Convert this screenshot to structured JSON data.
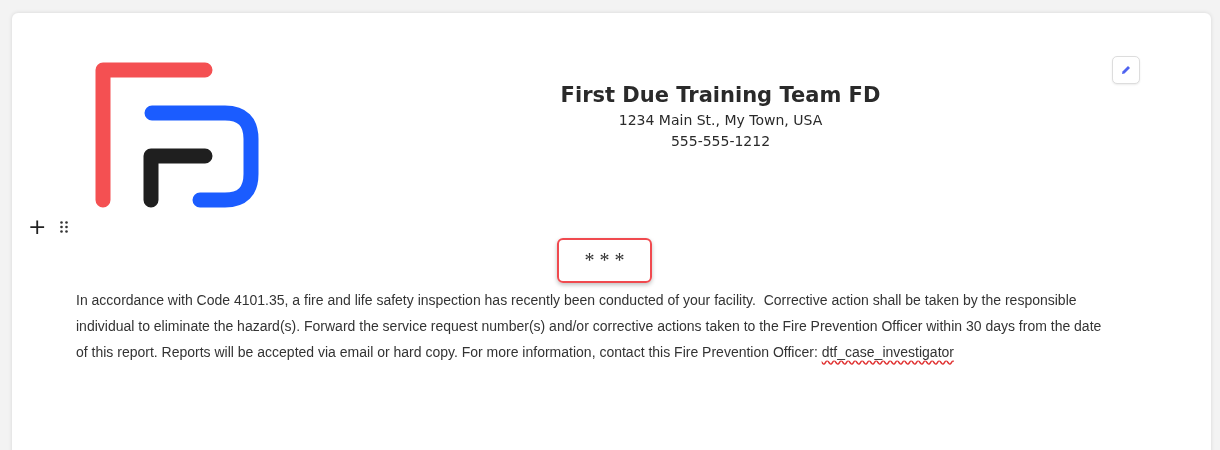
{
  "header": {
    "title": "First Due Training Team FD",
    "address": "1234 Main St., My Town, USA",
    "phone": "555-555-1212"
  },
  "block_tools": {
    "add": "+"
  },
  "separator": {
    "text": "* * *",
    "selected": true
  },
  "paragraph": {
    "text": "In accordance with Code 4101.35, a fire and life safety inspection has recently been conducted of your facility.  Corrective action shall be taken by the responsible individual to eliminate the hazard(s). Forward the service request number(s) and/or corrective actions taken to the Fire Prevention Officer within 30 days from the date of this report. Reports will be accepted via email or hard copy. For more information, contact this Fire Prevention Officer: ",
    "misspelled": "dtf_case_investigator"
  }
}
